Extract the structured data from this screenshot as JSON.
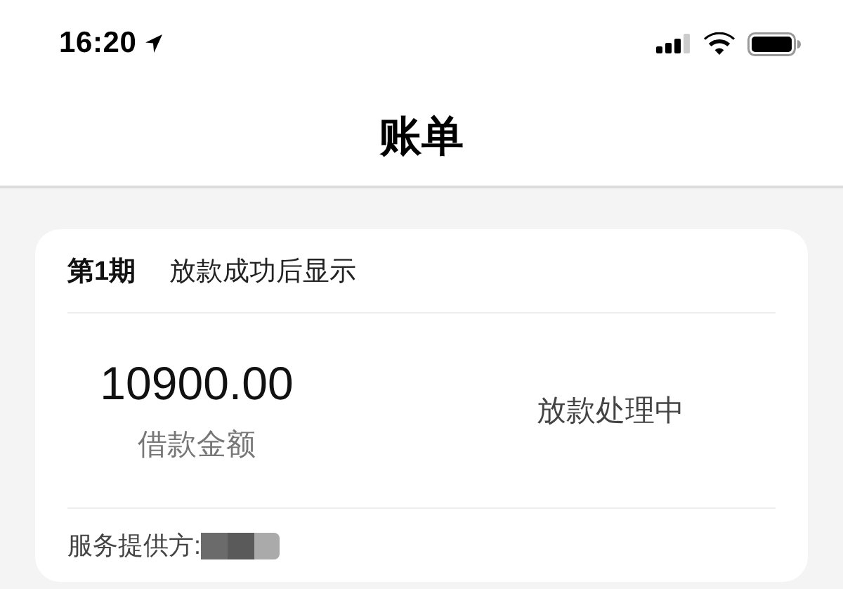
{
  "status_bar": {
    "time": "16:20"
  },
  "nav_bar": {
    "title": "账单"
  },
  "bill_card": {
    "period": "第1期",
    "period_note": "放款成功后显示",
    "amount": "10900.00",
    "amount_label": "借款金额",
    "status": "放款处理中",
    "provider_label": "服务提供方:"
  }
}
